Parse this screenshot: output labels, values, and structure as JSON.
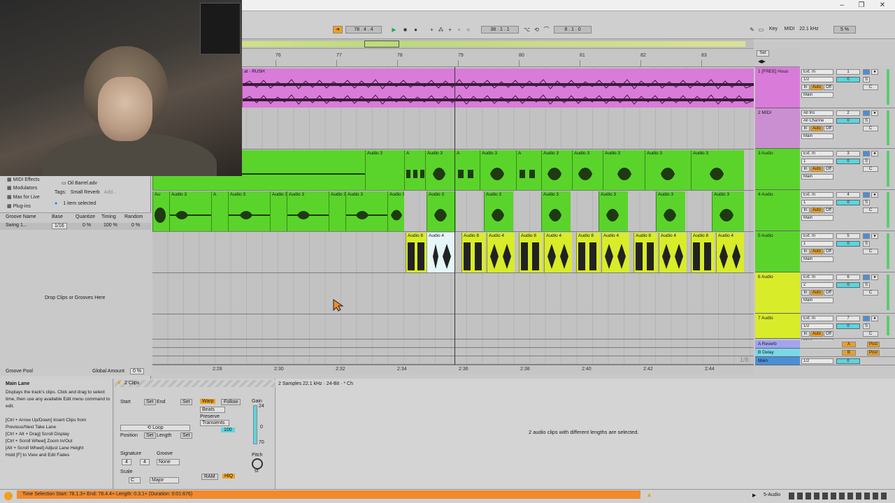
{
  "window": {
    "minimize": "–",
    "maximize": "❐",
    "close": "✕"
  },
  "transport": {
    "position": "78 . 4 . 4",
    "loop_start": "38 . 1 . 1",
    "loop_length": "8 . 1 . 0",
    "key_label": "Key",
    "midi_label": "MIDI",
    "sample_rate": "22.1 kHz",
    "cpu": "5 %"
  },
  "ruler": {
    "bars": [
      "76",
      "77",
      "78",
      "79",
      "80",
      "81",
      "82",
      "83"
    ],
    "set_label": "Set"
  },
  "time_ruler": {
    "labels": [
      "2:28",
      "2:30",
      "2:32",
      "2:34",
      "2:36",
      "2:38",
      "2:40",
      "2:42",
      "2:44"
    ],
    "zoom": "1/8"
  },
  "tracks": [
    {
      "name": "1 [FREE] Hous",
      "input": "Ext. In",
      "chan": "1/2",
      "num": "1",
      "monitor": [
        "In",
        "Auto",
        "Off"
      ],
      "out": "Main",
      "vol": "0",
      "pan": "C",
      "color": "#d97bd9"
    },
    {
      "name": "2 MIDI",
      "input": "All Ins",
      "chan": "All Channe",
      "num": "2",
      "monitor": [
        "In",
        "Auto",
        "Off"
      ],
      "out": "Main",
      "vol": "0",
      "pan": "C",
      "color": "#c98fd1"
    },
    {
      "name": "3 Audio",
      "input": "Ext. In",
      "chan": "1",
      "num": "3",
      "monitor": [
        "In",
        "Auto",
        "Off"
      ],
      "out": "Main",
      "vol": "0",
      "pan": "C",
      "color": "#5ad42a"
    },
    {
      "name": "4 Audio",
      "input": "Ext. In",
      "chan": "1",
      "num": "4",
      "monitor": [
        "In",
        "Auto",
        "Off"
      ],
      "out": "Main",
      "vol": "0",
      "pan": "C",
      "color": "#5ad42a"
    },
    {
      "name": "5 Audio",
      "input": "Ext. In",
      "chan": "1",
      "num": "5",
      "monitor": [
        "In",
        "Auto",
        "Off"
      ],
      "out": "Main",
      "vol": "0",
      "pan": "C",
      "color": "#5ad42a"
    },
    {
      "name": "6 Audio",
      "input": "Ext. In",
      "chan": "2",
      "num": "6",
      "monitor": [
        "In",
        "Auto",
        "Off"
      ],
      "out": "Main",
      "vol": "0",
      "pan": "C",
      "color": "#d8ec2a"
    },
    {
      "name": "7 Audio",
      "input": "Ext. In",
      "chan": "1/2",
      "num": "7",
      "monitor": [
        "In",
        "Auto",
        "Off"
      ],
      "out": "Main",
      "vol": "0",
      "pan": "C",
      "color": "#d8ec2a"
    }
  ],
  "returns": [
    {
      "name": "A Reverb",
      "letter": "A",
      "post": "Post",
      "color": "#a3a3f0"
    },
    {
      "name": "B Delay",
      "letter": "B",
      "post": "Post",
      "color": "#7ad8e8"
    },
    {
      "name": "Main",
      "letter": "",
      "post": "",
      "color": "#4a8fd8",
      "chan": "1/2",
      "vol": "0"
    }
  ],
  "clips": {
    "t1_label": "at - RUSH",
    "audio3": "Audio 3",
    "audio4": "Audio 4",
    "audio8": "Audio 8",
    "au": "Au",
    "a": "A"
  },
  "browser": {
    "items": [
      "MIDI Effects",
      "Modulators",
      "Max for Live",
      "Plug-ins"
    ],
    "file": "Oil Barrel.adv",
    "tags_label": "Tags:",
    "tag": "Small Reverb",
    "add": "Add...",
    "selected": "1 item selected"
  },
  "groove": {
    "cols": [
      "Groove Name",
      "Base",
      "Quantize",
      "Timing",
      "Random"
    ],
    "row": [
      "Swing 1...",
      "1/16",
      "0 %",
      "100 %",
      "0 %"
    ],
    "drop": "Drop Clips or Grooves Here",
    "pool": "Groove Pool",
    "global": "Global Amount",
    "global_val": "0 %"
  },
  "info": {
    "title": "Main Lane",
    "body": "Displays the track's clips. Click and drag to select time, then use any available Edit menu command to edit.",
    "hints": [
      "[Ctrl + Arrow Up/Down] Insert Clips from Previous/Next Take Lane",
      "[Ctrl + Alt + Drag] Scroll Display",
      "[Ctrl + Scroll Wheel] Zoom In/Out",
      "[Alt + Scroll Wheel] Adjust Lane Height",
      "Hold [F] to View and Edit Fades"
    ]
  },
  "detail": {
    "clips": "2 Clips",
    "start": "Start",
    "end": "End",
    "set": "Set",
    "loop": "Loop",
    "position": "Position",
    "length": "Length",
    "signature": "Signature",
    "groove": "Groove",
    "sig_num": "4",
    "sig_den": "4",
    "groove_val": "None",
    "scale": "Scale",
    "scale_root": "C",
    "scale_mode": "Major",
    "warp": "Warp",
    "follow": "Follow",
    "beats": "Beats",
    "preserve": "Preserve",
    "transients": "Transients",
    "val100": "100",
    "ram": "RAM",
    "hiq": "HiQ",
    "gain": "Gain",
    "pitch": "Pitch",
    "g24": "24",
    "g0": "0",
    "g70": "70",
    "st": "st"
  },
  "sample": {
    "header": "2 Samples  22.1 kHz · 24-Bit · * Ch",
    "msg": "2 audio clips with different lengths are selected."
  },
  "status": {
    "text": "Time Selection   Start: 78.1.3+   End: 78.4.4+   Length: 0.3.1+  (Duration: 0:01:676)",
    "track": "5-Audio"
  }
}
